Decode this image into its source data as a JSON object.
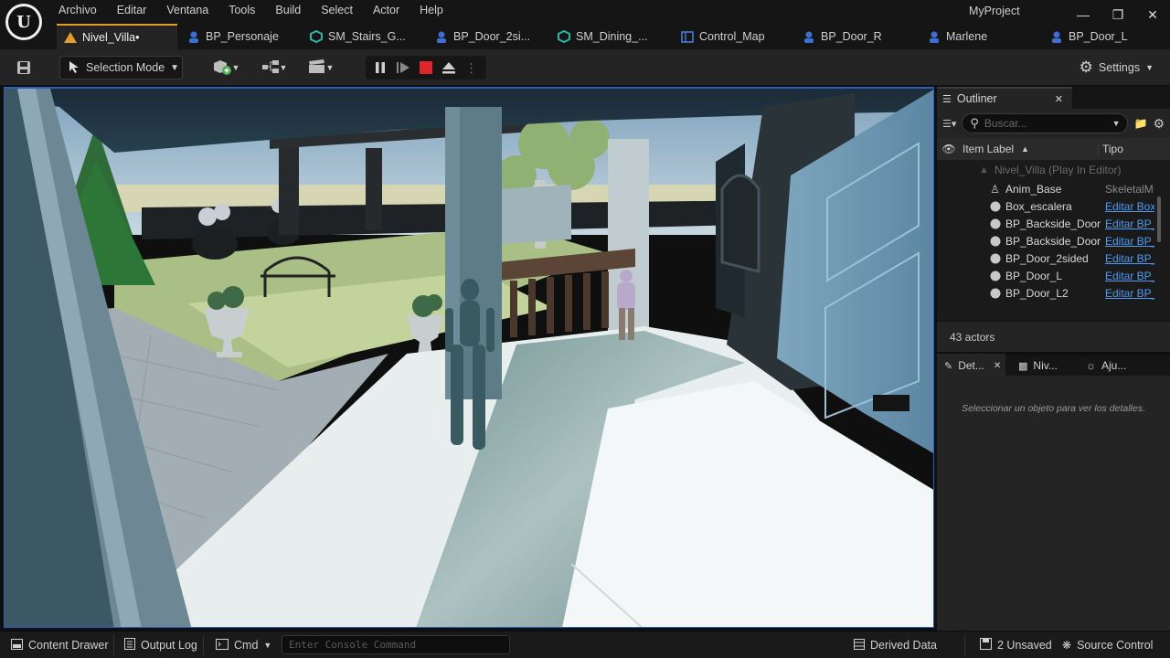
{
  "menu": [
    "Archivo",
    "Editar",
    "Ventana",
    "Tools",
    "Build",
    "Select",
    "Actor",
    "Help"
  ],
  "project_name": "MyProject",
  "tabs": [
    {
      "label": "Nivel_Villa•",
      "icon": "level-icon",
      "active": true
    },
    {
      "label": "BP_Personaje",
      "icon": "blueprint-icon"
    },
    {
      "label": "SM_Stairs_G...",
      "icon": "static-mesh-icon"
    },
    {
      "label": "BP_Door_2si...",
      "icon": "blueprint-icon"
    },
    {
      "label": "SM_Dining_...",
      "icon": "static-mesh-icon"
    },
    {
      "label": "Control_Map",
      "icon": "control-map-icon"
    },
    {
      "label": "BP_Door_R",
      "icon": "blueprint-icon"
    },
    {
      "label": "Marlene",
      "icon": "blueprint-icon"
    },
    {
      "label": "BP_Door_L",
      "icon": "blueprint-icon"
    }
  ],
  "toolbar": {
    "selection_mode": "Selection Mode",
    "settings": "Settings"
  },
  "outliner": {
    "title": "Outliner",
    "search_placeholder": "Buscar...",
    "col_label": "Item Label",
    "col_type": "Tipo",
    "root": "Nivel_Villa (Play In Editor)",
    "rows": [
      {
        "label": "Anim_Base",
        "type": "SkeletalM",
        "link": false
      },
      {
        "label": "Box_escalera",
        "type": "Editar Box",
        "link": true
      },
      {
        "label": "BP_Backside_Door",
        "type": "Editar BP_",
        "link": true
      },
      {
        "label": "BP_Backside_Door",
        "type": "Editar BP_",
        "link": true
      },
      {
        "label": "BP_Door_2sided",
        "type": "Editar BP_",
        "link": true
      },
      {
        "label": "BP_Door_L",
        "type": "Editar BP_",
        "link": true
      },
      {
        "label": "BP_Door_L2",
        "type": "Editar BP_",
        "link": true
      }
    ],
    "actor_count": "43 actors"
  },
  "details": {
    "tabs": [
      "Det...",
      "Niv...",
      "Aju..."
    ],
    "empty_msg": "Seleccionar un objeto para ver los detalles."
  },
  "bottom": {
    "content_drawer": "Content Drawer",
    "output_log": "Output Log",
    "cmd": "Cmd",
    "console_placeholder": "Enter Console Command",
    "derived_data": "Derived Data",
    "unsaved": "2 Unsaved",
    "source_control": "Source Control"
  },
  "colors": {
    "accent": "#e59c2b",
    "link": "#4e9cf0",
    "play_stop": "#e0242c",
    "viewport_border": "#2b5fb5"
  }
}
